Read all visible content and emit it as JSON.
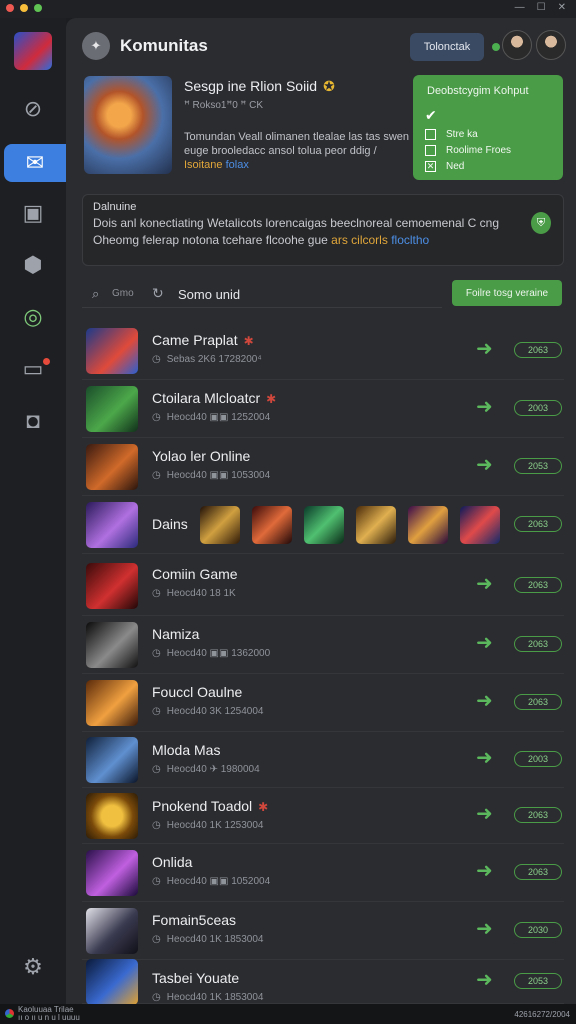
{
  "window": {
    "traffic_colors": [
      "#ee5a52",
      "#f6be3b",
      "#5fc454"
    ]
  },
  "header": {
    "title": "Komunitas",
    "button_label": "Tolonctak",
    "status_color": "#4caf50"
  },
  "sidebar": {
    "items": [
      {
        "icon": "speedometer-icon",
        "glyph": "⊘"
      },
      {
        "icon": "mail-icon",
        "glyph": "✉",
        "active": true
      },
      {
        "icon": "briefcase-icon",
        "glyph": "▣"
      },
      {
        "icon": "cube-icon",
        "glyph": "⬢"
      },
      {
        "icon": "target-icon",
        "glyph": "◎"
      },
      {
        "icon": "monitor-icon",
        "glyph": "▭",
        "notification": true
      },
      {
        "icon": "camera-icon",
        "glyph": "◘"
      }
    ],
    "settings_icon": "gear-icon"
  },
  "featured": {
    "title": "Sesgp ine Rlion Soiid",
    "meta": "ꟸ Rokso1ꟸ0 ꟸ CK",
    "desc_prefix": "Tomundan Veall olimanen tlealae las tas swen euge brooledacc ansol tolua peor ddig / ",
    "desc_hl1": "Isoitane",
    "desc_hl2": "folax"
  },
  "green_panel": {
    "title": "Deobstcygim Kohput",
    "items": [
      {
        "label": "Stre ka",
        "state": "check"
      },
      {
        "label": "Roolime Froes",
        "state": "empty"
      },
      {
        "label": "Ned",
        "state": "x"
      }
    ]
  },
  "infobox": {
    "title": "Dalnuine",
    "text_prefix": "Dois anl konectiating Wetalicots lorencaigas beeclnoreal cemoemenal C cng Oheomg felerap notona tcehare flcoohe gue ",
    "text_hl1": "ars cilcorls",
    "text_hl2": "flocltho"
  },
  "search": {
    "placeholder": "Gmo",
    "label": "Somo unid",
    "button_label": "Foilre tosg veraine"
  },
  "games": [
    {
      "title": "Came Praplat",
      "badge": "✱",
      "meta": "Sebas 2K6 1728200⁴",
      "pill": "2063"
    },
    {
      "title": "Ctoilara Mlcloatcr",
      "badge": "✱",
      "meta": "Heocd40 ▣▣ 1252004",
      "pill": "2003"
    },
    {
      "title": "Yolao ler Online",
      "badge": "",
      "meta": "Heocd40 ▣▣ 1053004",
      "pill": "2053"
    },
    {
      "title": "Dains",
      "badge": "",
      "meta": "",
      "pill": "2063"
    },
    {
      "title": "Comiin Game",
      "badge": "",
      "meta": "Heocd40 18 1K",
      "pill": "2063"
    },
    {
      "title": "Namiza",
      "badge": "",
      "meta": "Heocd40 ▣▣ 1362000",
      "pill": "2063"
    },
    {
      "title": "Fouccl Oaulne",
      "badge": "",
      "meta": "Heocd40 3K 1254004",
      "pill": "2063"
    },
    {
      "title": "Mloda Mas",
      "badge": "",
      "meta": "Heocd40 ✈ 1980004",
      "pill": "2003"
    },
    {
      "title": "Pnokend Toadol",
      "badge": "✱",
      "meta": "Heocd40 1K 1253004",
      "pill": "2063"
    },
    {
      "title": "Onlida",
      "badge": "",
      "meta": "Heocd40 ▣▣ 1052004",
      "pill": "2063"
    },
    {
      "title": "Fomain5ceas",
      "badge": "",
      "meta": "Heocd40 1K 1853004",
      "pill": "2030"
    },
    {
      "title": "Tasbei Youate",
      "badge": "",
      "meta": "Heocd40 1K 1853004",
      "pill": "2053"
    }
  ],
  "statusbar": {
    "left_line1": "Kaoluuaa Trilae",
    "left_line2": "ıı o ıı u n u l uuuu",
    "right": "42616272/2004"
  }
}
